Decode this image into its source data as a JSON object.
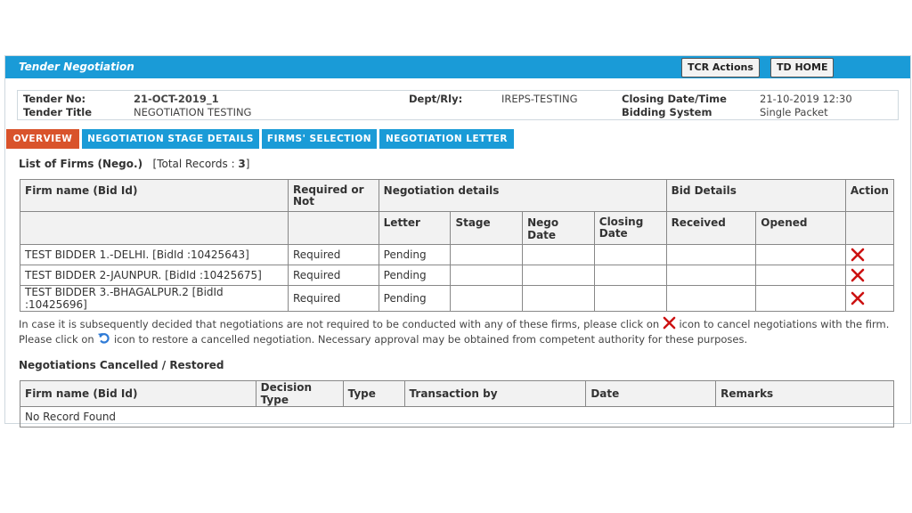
{
  "header": {
    "title": "Tender Negotiation",
    "buttons": {
      "tcr_actions": "TCR Actions",
      "td_home": "TD HOME"
    }
  },
  "info": {
    "tender_no_label": "Tender No:",
    "tender_no": "21-OCT-2019_1",
    "tender_title_label": "Tender Title",
    "tender_title": "NEGOTIATION TESTING",
    "dept_label": "Dept/Rly:",
    "dept": "IREPS-TESTING",
    "closing_label": "Closing Date/Time",
    "closing": "21-10-2019 12:30",
    "bidding_label": "Bidding System",
    "bidding": "Single Packet"
  },
  "tabs": [
    {
      "label": "OVERVIEW",
      "active": true
    },
    {
      "label": "NEGOTIATION STAGE DETAILS",
      "active": false
    },
    {
      "label": "FIRMS' SELECTION",
      "active": false
    },
    {
      "label": "NEGOTIATION LETTER",
      "active": false
    }
  ],
  "firms_list": {
    "heading": "List of Firms (Nego.)",
    "total_prefix": "[Total Records : ",
    "total": "3",
    "total_suffix": "]",
    "headers": {
      "firm_name": "Firm name (Bid Id)",
      "required": "Required or Not",
      "nego_details": "Negotiation details",
      "bid_details": "Bid Details",
      "action": "Action",
      "letter": "Letter",
      "stage": "Stage",
      "nego_date": "Nego Date",
      "closing_date": "Closing Date",
      "received": "Received",
      "opened": "Opened"
    },
    "rows": [
      {
        "firm": "TEST BIDDER 1.-DELHI. [BidId :10425643]",
        "required": "Required",
        "letter": "Pending",
        "stage": "",
        "nego_date": "",
        "closing_date": "",
        "received": "",
        "opened": ""
      },
      {
        "firm": "TEST BIDDER 2-JAUNPUR. [BidId :10425675]",
        "required": "Required",
        "letter": "Pending",
        "stage": "",
        "nego_date": "",
        "closing_date": "",
        "received": "",
        "opened": ""
      },
      {
        "firm": "TEST BIDDER 3.-BHAGALPUR.2 [BidId :10425696]",
        "required": "Required",
        "letter": "Pending",
        "stage": "",
        "nego_date": "",
        "closing_date": "",
        "received": "",
        "opened": ""
      }
    ]
  },
  "note": {
    "part1": "In case it is subsequently decided that negotiations are not required to be conducted with any of these firms, please click on",
    "part2": "icon to cancel negotiations with the firm. Please click on",
    "part3": "icon to restore a cancelled negotiation. Necessary approval may be obtained from competent authority for these purposes."
  },
  "cancelled": {
    "heading": "Negotiations Cancelled / Restored",
    "headers": {
      "firm_name": "Firm name (Bid Id)",
      "decision_type": "Decision Type",
      "type": "Type",
      "transaction_by": "Transaction by",
      "date": "Date",
      "remarks": "Remarks"
    },
    "empty": "No Record Found"
  },
  "colors": {
    "title_bar": "#1a9bd7",
    "active_tab": "#d9532b",
    "cancel_icon": "#cc1111",
    "restore_icon": "#2f7bd6"
  }
}
